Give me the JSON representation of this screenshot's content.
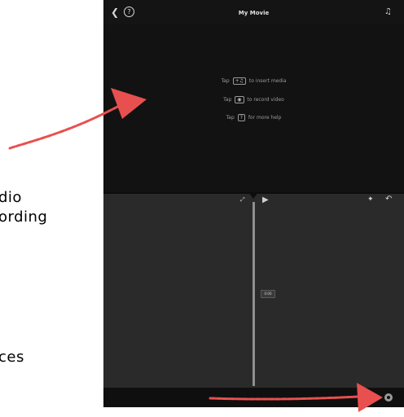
{
  "side_text": {
    "line1": "dio",
    "line2": "ording",
    "line3": "ces"
  },
  "app": {
    "title": "My Movie",
    "top_icons": [
      "back-chevron-icon",
      "help-icon",
      "media-library-icon"
    ],
    "preview": {
      "hints": [
        {
          "prefix": "Tap",
          "icon_label": "+♫",
          "suffix": "to insert media"
        },
        {
          "prefix": "Tap",
          "icon_label": "◉",
          "suffix": "to record video"
        },
        {
          "prefix": "Tap",
          "icon_label": "?",
          "suffix": "for more help"
        }
      ]
    },
    "timeline": {
      "clip_label": "0:00"
    }
  },
  "colors": {
    "app_bg": "#1d1d1d",
    "arrow": "#e8504f"
  }
}
